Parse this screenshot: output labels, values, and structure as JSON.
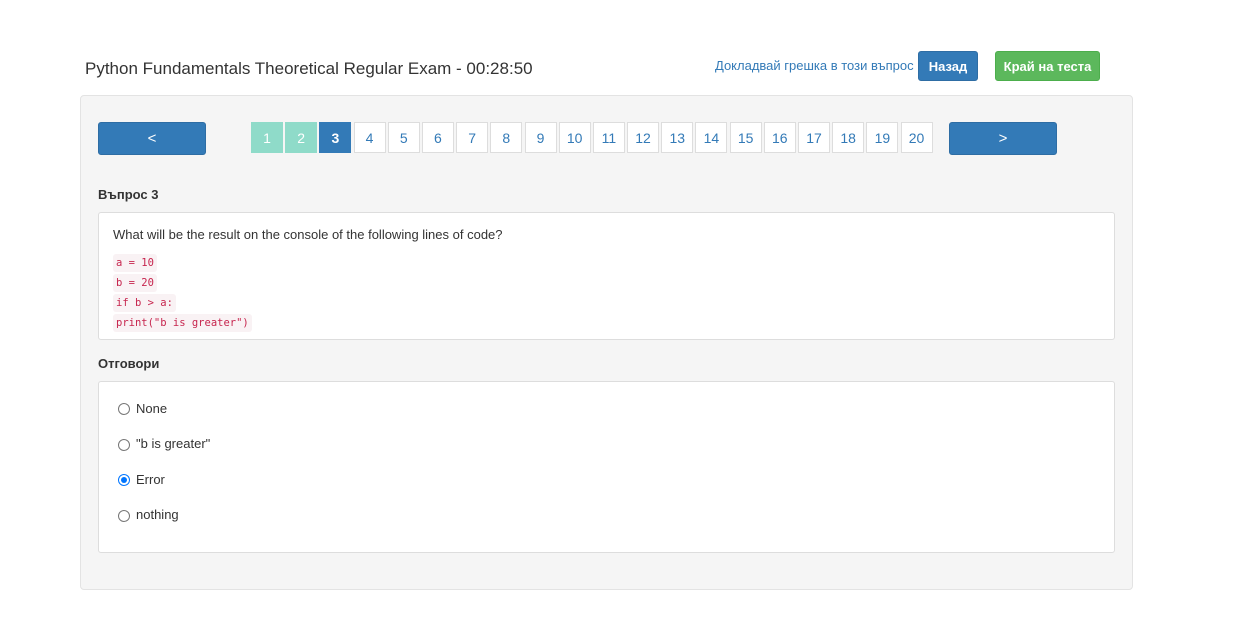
{
  "header": {
    "title": "Python Fundamentals Theoretical Regular Exam - 00:28:50",
    "report_link": "Докладвай грешка в този въпрос",
    "back_button": "Назад",
    "end_button": "Край на теста"
  },
  "navigation": {
    "prev_label": "<",
    "next_label": ">",
    "pages": [
      "1",
      "2",
      "3",
      "4",
      "5",
      "6",
      "7",
      "8",
      "9",
      "10",
      "11",
      "12",
      "13",
      "14",
      "15",
      "16",
      "17",
      "18",
      "19",
      "20"
    ],
    "answered_pages": [
      1,
      2
    ],
    "current_page": 3
  },
  "question": {
    "label": "Въпрос 3",
    "text": "What will be the result on the console of the following lines of code?",
    "code": [
      "a = 10",
      "b = 20",
      "if b > a:",
      "print(\"b is greater\")"
    ]
  },
  "answers": {
    "label": "Отговори",
    "options": [
      "None",
      "\"b is greater\"",
      "Error",
      "nothing"
    ],
    "selected_index": 2
  },
  "colors": {
    "primary": "#337ab7",
    "success": "#5cb85c",
    "answered": "#8fdbc9",
    "code_text": "#c7254e"
  }
}
